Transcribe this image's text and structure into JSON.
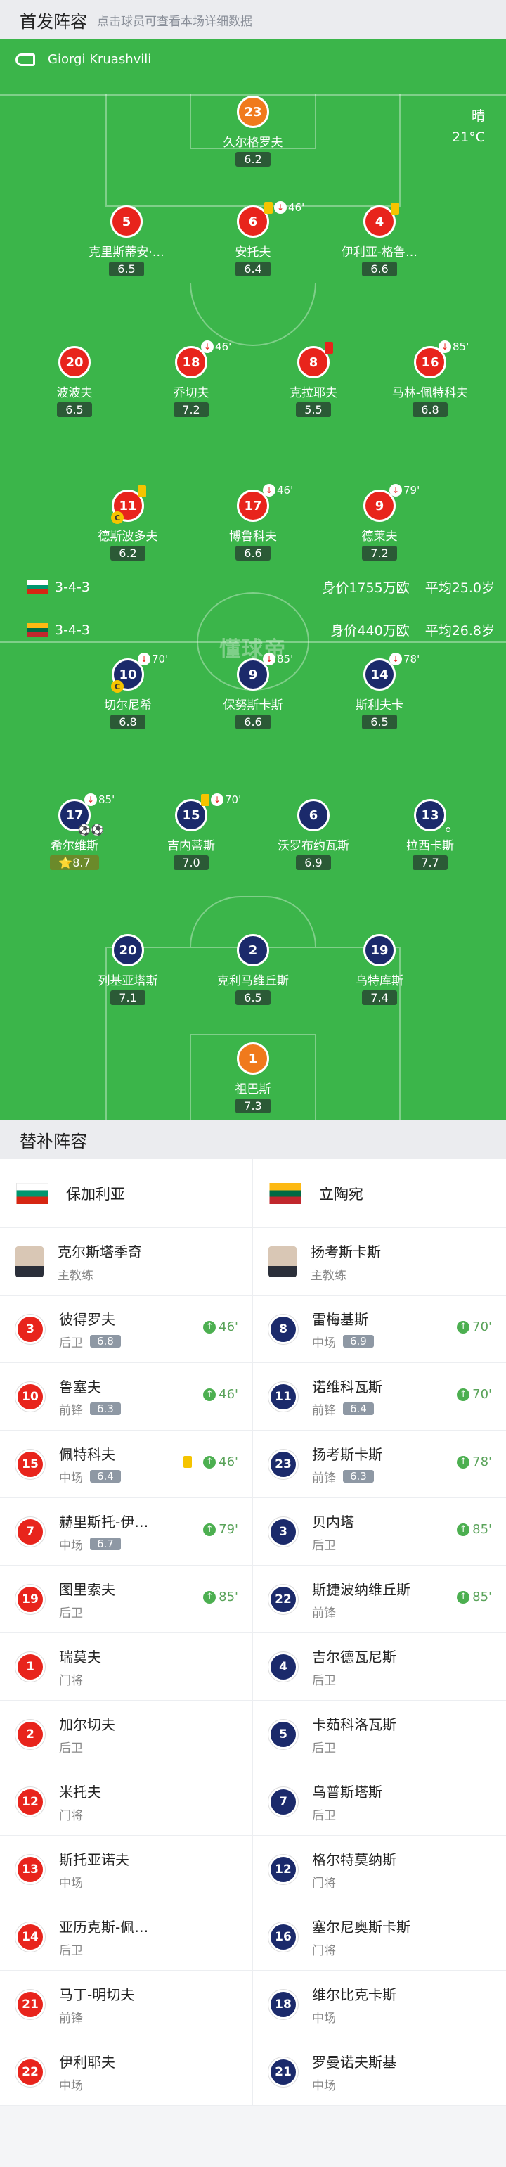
{
  "header": {
    "title": "首发阵容",
    "subtitle": "点击球员可查看本场详细数据"
  },
  "referee": "Giorgi Kruashvili",
  "weather": {
    "condition": "晴",
    "temp": "21°C"
  },
  "teams": {
    "home": {
      "formation": "3-4-3",
      "market_value": "身价1755万欧",
      "avg_age": "平均25.0岁",
      "name": "保加利亚"
    },
    "away": {
      "formation": "3-4-3",
      "market_value": "身价440万欧",
      "avg_age": "平均26.8岁",
      "name": "立陶宛"
    }
  },
  "watermark": "懂球帝",
  "home_players": [
    {
      "num": "23",
      "name": "久尔格罗夫",
      "rating": "6.2",
      "sub": "",
      "card": ""
    },
    {
      "num": "5",
      "name": "克里斯蒂安·…",
      "rating": "6.5",
      "sub": "",
      "card": ""
    },
    {
      "num": "6",
      "name": "安托夫",
      "rating": "6.4",
      "sub": "46'",
      "card": "yellow"
    },
    {
      "num": "4",
      "name": "伊利亚-格鲁…",
      "rating": "6.6",
      "sub": "",
      "card": "yellow"
    },
    {
      "num": "20",
      "name": "波波夫",
      "rating": "6.5",
      "sub": "",
      "card": ""
    },
    {
      "num": "18",
      "name": "乔切夫",
      "rating": "7.2",
      "sub": "46'",
      "card": ""
    },
    {
      "num": "8",
      "name": "克拉耶夫",
      "rating": "5.5",
      "sub": "",
      "card": "red"
    },
    {
      "num": "16",
      "name": "马林-佩特科夫",
      "rating": "6.8",
      "sub": "85'",
      "card": ""
    },
    {
      "num": "11",
      "name": "德斯波多夫",
      "rating": "6.2",
      "sub": "",
      "card": "yellow"
    },
    {
      "num": "17",
      "name": "博鲁科夫",
      "rating": "6.6",
      "sub": "46'",
      "card": ""
    },
    {
      "num": "9",
      "name": "德莱夫",
      "rating": "7.2",
      "sub": "79'",
      "card": ""
    }
  ],
  "away_players": [
    {
      "num": "10",
      "name": "切尔尼希",
      "rating": "6.8",
      "sub": "70'",
      "card": ""
    },
    {
      "num": "9",
      "name": "保努斯卡斯",
      "rating": "6.6",
      "sub": "85'",
      "card": ""
    },
    {
      "num": "14",
      "name": "斯利夫卡",
      "rating": "6.5",
      "sub": "78'",
      "card": ""
    },
    {
      "num": "17",
      "name": "希尔维斯",
      "rating": "8.7",
      "sub": "85'",
      "card": ""
    },
    {
      "num": "15",
      "name": "吉内蒂斯",
      "rating": "7.0",
      "sub": "70'",
      "card": "yellow"
    },
    {
      "num": "6",
      "name": "沃罗布约瓦斯",
      "rating": "6.9",
      "sub": "",
      "card": ""
    },
    {
      "num": "13",
      "name": "拉西卡斯",
      "rating": "7.7",
      "sub": "",
      "card": ""
    },
    {
      "num": "20",
      "name": "列基亚塔斯",
      "rating": "7.1",
      "sub": "",
      "card": ""
    },
    {
      "num": "2",
      "name": "克利马维丘斯",
      "rating": "6.5",
      "sub": "",
      "card": ""
    },
    {
      "num": "19",
      "name": "乌特库斯",
      "rating": "7.4",
      "sub": "",
      "card": ""
    },
    {
      "num": "1",
      "name": "祖巴斯",
      "rating": "7.3",
      "sub": "",
      "card": ""
    }
  ],
  "subs_header": "替补阵容",
  "home_coach": {
    "name": "克尔斯塔季奇",
    "role": "主教练"
  },
  "away_coach": {
    "name": "扬考斯卡斯",
    "role": "主教练"
  },
  "home_subs": [
    {
      "num": "3",
      "name": "彼得罗夫",
      "pos": "后卫",
      "rating": "6.8",
      "in": "46'",
      "card": ""
    },
    {
      "num": "10",
      "name": "鲁塞夫",
      "pos": "前锋",
      "rating": "6.3",
      "in": "46'",
      "card": ""
    },
    {
      "num": "15",
      "name": "佩特科夫",
      "pos": "中场",
      "rating": "6.4",
      "in": "46'",
      "card": "yellow"
    },
    {
      "num": "7",
      "name": "赫里斯托-伊…",
      "pos": "中场",
      "rating": "6.7",
      "in": "79'",
      "card": ""
    },
    {
      "num": "19",
      "name": "图里索夫",
      "pos": "后卫",
      "rating": "",
      "in": "85'",
      "card": ""
    },
    {
      "num": "1",
      "name": "瑞莫夫",
      "pos": "门将",
      "rating": "",
      "in": "",
      "card": ""
    },
    {
      "num": "2",
      "name": "加尔切夫",
      "pos": "后卫",
      "rating": "",
      "in": "",
      "card": ""
    },
    {
      "num": "12",
      "name": "米托夫",
      "pos": "门将",
      "rating": "",
      "in": "",
      "card": ""
    },
    {
      "num": "13",
      "name": "斯托亚诺夫",
      "pos": "中场",
      "rating": "",
      "in": "",
      "card": ""
    },
    {
      "num": "14",
      "name": "亚历克斯-佩…",
      "pos": "后卫",
      "rating": "",
      "in": "",
      "card": ""
    },
    {
      "num": "21",
      "name": "马丁-明切夫",
      "pos": "前锋",
      "rating": "",
      "in": "",
      "card": ""
    },
    {
      "num": "22",
      "name": "伊利耶夫",
      "pos": "中场",
      "rating": "",
      "in": "",
      "card": ""
    }
  ],
  "away_subs": [
    {
      "num": "8",
      "name": "雷梅基斯",
      "pos": "中场",
      "rating": "6.9",
      "in": "70'",
      "card": ""
    },
    {
      "num": "11",
      "name": "诺维科瓦斯",
      "pos": "前锋",
      "rating": "6.4",
      "in": "70'",
      "card": ""
    },
    {
      "num": "23",
      "name": "扬考斯卡斯",
      "pos": "前锋",
      "rating": "6.3",
      "in": "78'",
      "card": ""
    },
    {
      "num": "3",
      "name": "贝内塔",
      "pos": "后卫",
      "rating": "",
      "in": "85'",
      "card": ""
    },
    {
      "num": "22",
      "name": "斯捷波纳维丘斯",
      "pos": "前锋",
      "rating": "",
      "in": "85'",
      "card": ""
    },
    {
      "num": "4",
      "name": "吉尔德瓦尼斯",
      "pos": "后卫",
      "rating": "",
      "in": "",
      "card": ""
    },
    {
      "num": "5",
      "name": "卡茹科洛瓦斯",
      "pos": "后卫",
      "rating": "",
      "in": "",
      "card": ""
    },
    {
      "num": "7",
      "name": "乌普斯塔斯",
      "pos": "后卫",
      "rating": "",
      "in": "",
      "card": ""
    },
    {
      "num": "12",
      "name": "格尔特莫纳斯",
      "pos": "门将",
      "rating": "",
      "in": "",
      "card": ""
    },
    {
      "num": "16",
      "name": "塞尔尼奥斯卡斯",
      "pos": "门将",
      "rating": "",
      "in": "",
      "card": ""
    },
    {
      "num": "18",
      "name": "维尔比克卡斯",
      "pos": "中场",
      "rating": "",
      "in": "",
      "card": ""
    },
    {
      "num": "21",
      "name": "罗曼诺夫斯基",
      "pos": "中场",
      "rating": "",
      "in": "",
      "card": ""
    }
  ]
}
